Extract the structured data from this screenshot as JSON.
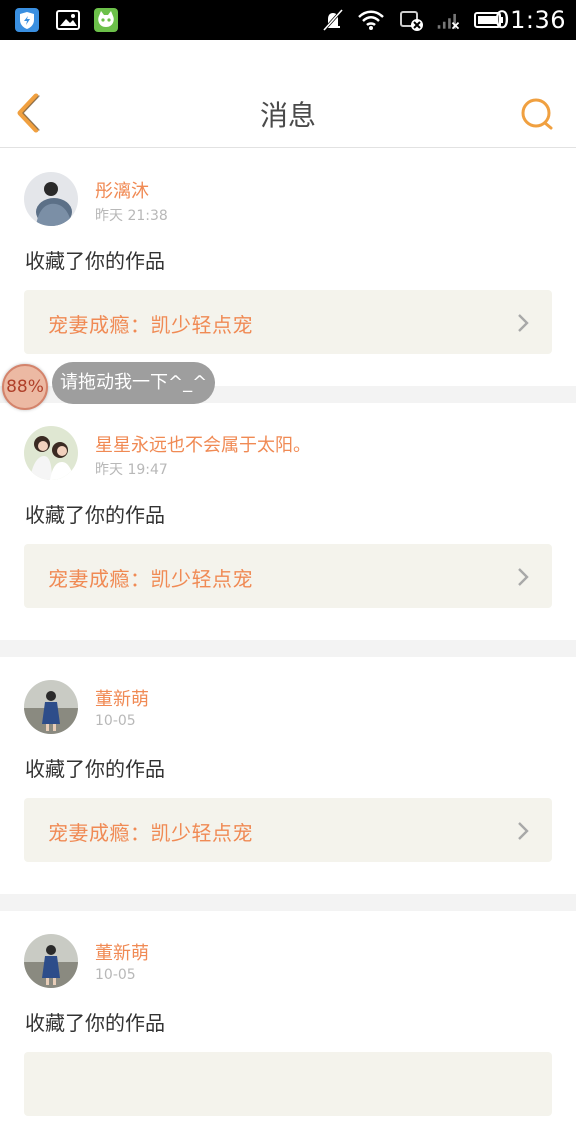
{
  "status_bar": {
    "time": "01:36"
  },
  "header": {
    "title": "消息"
  },
  "messages": [
    {
      "username": "彤漓沐",
      "time": "昨天 21:38",
      "action": "收藏了你的作品",
      "work_title": "宠妻成瘾：凯少轻点宠"
    },
    {
      "username": "星星永远也不会属于太阳。",
      "time": "昨天 19:47",
      "action": "收藏了你的作品",
      "work_title": "宠妻成瘾：凯少轻点宠"
    },
    {
      "username": "董新萌",
      "time": "10-05",
      "action": "收藏了你的作品",
      "work_title": "宠妻成瘾：凯少轻点宠"
    },
    {
      "username": "董新萌",
      "time": "10-05",
      "action": "收藏了你的作品",
      "work_title": ""
    }
  ],
  "floating_widget": {
    "percent": "88%",
    "tip": "请拖动我一下^_^"
  },
  "colors": {
    "accent": "#f08a54",
    "header_icon": "#f0a040",
    "card_bg": "#f4f3ec"
  }
}
